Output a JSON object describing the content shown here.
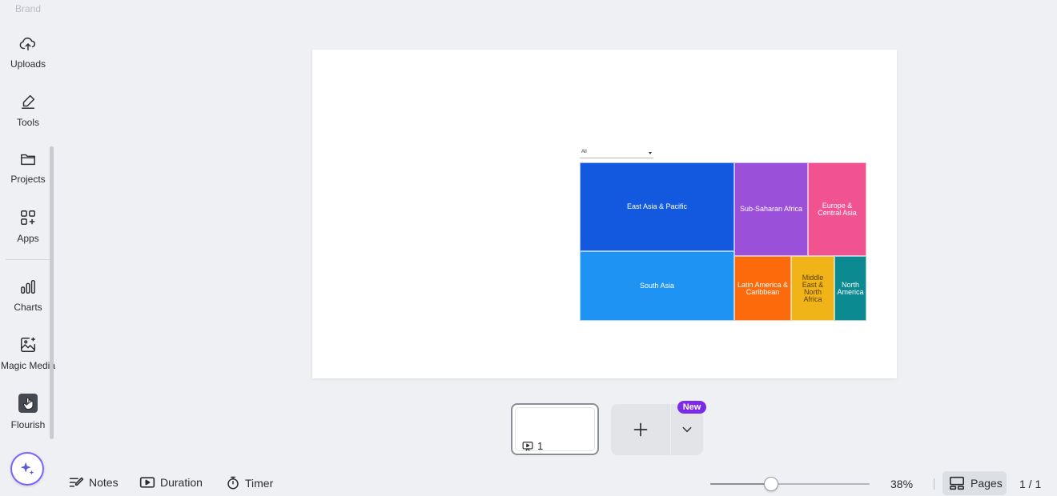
{
  "sidebar": {
    "brand_label": "Brand",
    "items": [
      {
        "label": "Uploads",
        "icon": "cloud-upload-icon"
      },
      {
        "label": "Tools",
        "icon": "pen-icon"
      },
      {
        "label": "Projects",
        "icon": "folder-icon"
      },
      {
        "label": "Apps",
        "icon": "apps-grid-icon"
      },
      {
        "label": "Charts",
        "icon": "bar-chart-icon"
      },
      {
        "label": "Magic Media",
        "icon": "magic-image-icon"
      },
      {
        "label": "Flourish",
        "icon": "flourish-icon"
      }
    ]
  },
  "canvas": {
    "filter_value": "All",
    "treemap": [
      {
        "label": "East Asia & Pacific",
        "color": "#1359df"
      },
      {
        "label": "South Asia",
        "color": "#1f93f4"
      },
      {
        "label": "Sub-Saharan Africa",
        "color": "#9a50d8"
      },
      {
        "label": "Europe & Central Asia",
        "color": "#f0538f"
      },
      {
        "label": "Latin America & Caribbean",
        "color": "#fd6a0b"
      },
      {
        "label": "Middle East & North Africa",
        "color": "#f0b418"
      },
      {
        "label": "North America",
        "color": "#0b8a91"
      }
    ]
  },
  "pages": {
    "thumb_number": "1",
    "new_badge": "New"
  },
  "bottombar": {
    "notes": "Notes",
    "duration": "Duration",
    "timer": "Timer",
    "zoom": "38%",
    "zoom_value": 38,
    "pages": "Pages",
    "page_count": "1 / 1"
  },
  "colors": {
    "accent": "#7d2ae8",
    "magic_ring": "#7b61ff"
  }
}
